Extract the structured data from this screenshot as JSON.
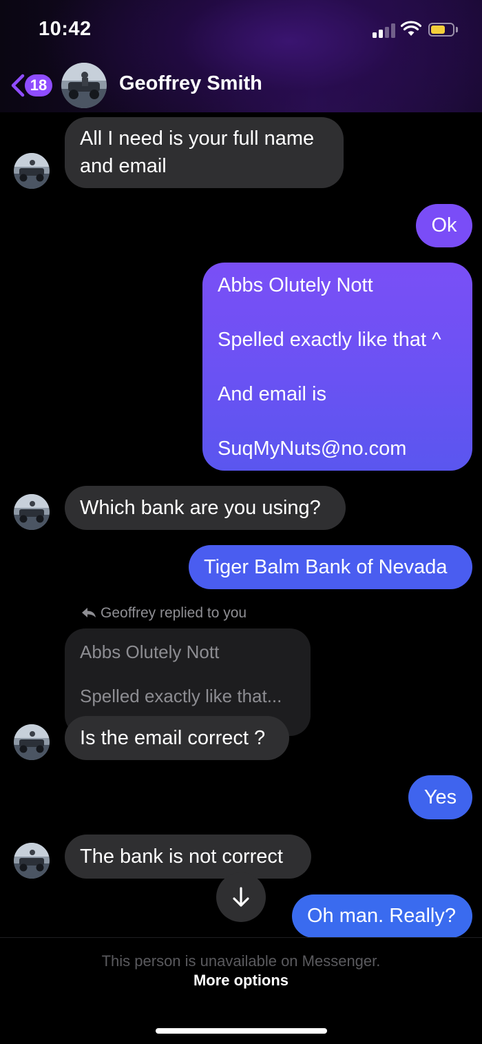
{
  "status_bar": {
    "time": "10:42",
    "battery_level": 0.6,
    "signal_bars": 2
  },
  "header": {
    "back_badge": "18",
    "contact_name": "Geoffrey Smith"
  },
  "messages": [
    {
      "from": "them",
      "text_lines": [
        "All I need is your full name",
        "and email"
      ]
    },
    {
      "from": "me",
      "text": "Ok"
    },
    {
      "from": "me",
      "paragraphs": [
        "Abbs Olutely Nott",
        "Spelled exactly like that ^",
        "And email is",
        "SuqMyNuts@no.com"
      ]
    },
    {
      "from": "them",
      "text": "Which bank are you using?"
    },
    {
      "from": "me",
      "text": "Tiger Balm Bank of Nevada"
    },
    {
      "from": "them",
      "text": "Is the email correct ?"
    },
    {
      "from": "me",
      "text": "Yes"
    },
    {
      "from": "them",
      "text": "The bank is not correct"
    },
    {
      "from": "me",
      "text": "Oh man. Really?"
    }
  ],
  "reply": {
    "label": "Geoffrey replied to you",
    "quoted_lines": [
      "Abbs Olutely Nott",
      "Spelled exactly like that..."
    ]
  },
  "footer": {
    "note": "This person is unavailable on Messenger.",
    "more_options": "More options"
  },
  "icons": {
    "back": "chevron-left-icon",
    "scroll_down": "arrow-down-icon",
    "reply": "reply-arrow-icon"
  },
  "colors": {
    "accent_purple": "#8f4dff",
    "incoming_bubble": "#2f2f31",
    "outgoing_blue": "#4a5df0"
  }
}
